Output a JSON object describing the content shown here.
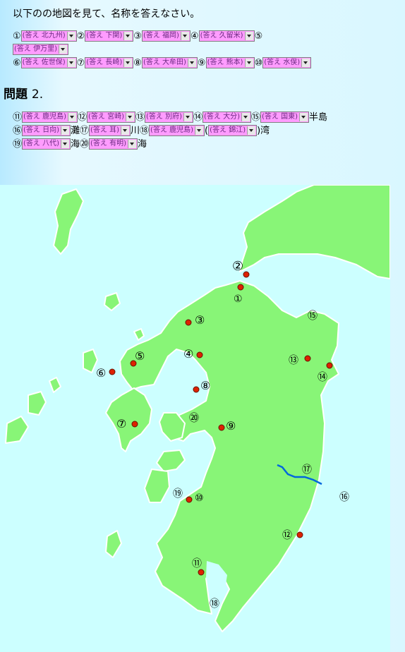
{
  "instruction": "以下のの地図を見て、名称を答えなさい。",
  "q2_title": "問題",
  "q2_number": "2.",
  "answers": {
    "a1": "(答え 北九州)",
    "a2": "(答え 下関)",
    "a3": "(答え 福岡)",
    "a4": "(答え 久留米)",
    "a5": "(答え 伊万里)",
    "a6": "(答え 佐世保)",
    "a7": "(答え 長崎)",
    "a8": "(答え 大牟田)",
    "a9": "(答え 熊本)",
    "a10": "(答え 水俣)",
    "a11": "(答え 鹿児島)",
    "a12": "(答え 宮崎)",
    "a13": "(答え 別府)",
    "a14": "(答え 大分)",
    "a15": "(答え 国東)",
    "a16": "(答え 日向)",
    "a17": "(答え 耳)",
    "a18a": "(答え 鹿児島)",
    "a18b": "(答え 錦江)",
    "a19": "(答え 八代)",
    "a20": "(答え 有明)"
  },
  "numbers": {
    "n1": "①",
    "n2": "②",
    "n3": "③",
    "n4": "④",
    "n5": "⑤",
    "n6": "⑥",
    "n7": "⑦",
    "n8": "⑧",
    "n9": "⑨",
    "n10": "⑩",
    "n11": "⑪",
    "n12": "⑫",
    "n13": "⑬",
    "n14": "⑭",
    "n15": "⑮",
    "n16": "⑯",
    "n17": "⑰",
    "n18": "⑱",
    "n19": "⑲",
    "n20": "⑳"
  },
  "suffixes": {
    "s15": "半島",
    "s16": "灘",
    "s17": "川",
    "s18_open": "(",
    "s18_close": ")湾",
    "s19": "海",
    "s20": "海"
  },
  "map_labels": {
    "m1": "①",
    "m2": "②",
    "m3": "③",
    "m4": "④",
    "m5": "⑤",
    "m6": "⑥",
    "m7": "⑦",
    "m8": "⑧",
    "m9": "⑨",
    "m10": "⑩",
    "m11": "⑪",
    "m12": "⑫",
    "m13": "⑬",
    "m14": "⑭",
    "m15": "⑮",
    "m16": "⑯",
    "m17": "⑰",
    "m18": "⑱",
    "m19": "⑲",
    "m20": "⑳"
  },
  "colors": {
    "land": "#88f577",
    "sea": "#ccffff",
    "marker": "#dd2200",
    "river": "#0066dd",
    "select_bg": "#ff9cff"
  }
}
